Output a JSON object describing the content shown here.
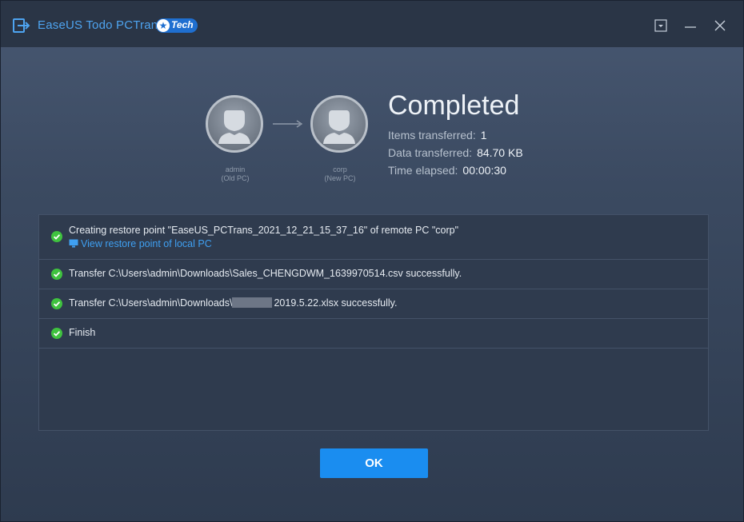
{
  "app": {
    "title": "EaseUS Todo PCTrans",
    "badge": "Tech",
    "accent_color": "#1a8df0"
  },
  "window_controls": {
    "menu_icon": "dropdown-menu-icon",
    "minimize_icon": "minimize-icon",
    "close_icon": "close-icon"
  },
  "source_pc": {
    "name": "admin",
    "role": "(Old PC)"
  },
  "target_pc": {
    "name": "corp",
    "role": "(New PC)"
  },
  "result": {
    "status": "Completed",
    "items_label": "Items transferred:",
    "items_value": "1",
    "data_label": "Data transferred:",
    "data_value": "84.70 KB",
    "time_label": "Time elapsed:",
    "time_value": "00:00:30"
  },
  "log": {
    "rows": [
      {
        "text": "Creating restore point \"EaseUS_PCTrans_2021_12_21_15_37_16\" of remote PC \"corp\"",
        "link": "View restore point of local PC",
        "status": "success"
      },
      {
        "text": "Transfer C:\\Users\\admin\\Downloads\\Sales_CHENGDWM_1639970514.csv successfully.",
        "status": "success"
      },
      {
        "text_prefix": "Transfer C:\\Users\\admin\\Downloads\\",
        "text_suffix": "2019.5.22.xlsx successfully.",
        "status": "success"
      },
      {
        "text": "Finish",
        "status": "success"
      }
    ]
  },
  "ok_button": {
    "label": "OK"
  }
}
